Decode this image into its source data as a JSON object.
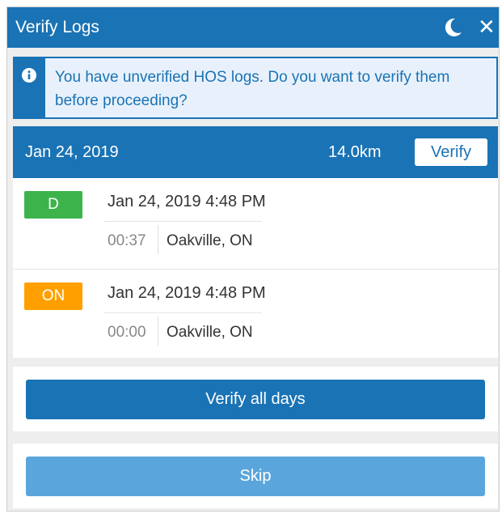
{
  "window": {
    "title": "Verify Logs"
  },
  "titlebar": {
    "theme_icon": "moon-icon",
    "close_glyph": "✕"
  },
  "alert": {
    "icon": "info-icon",
    "message": "You have unverified HOS logs. Do you want to verify them before proceeding?"
  },
  "day": {
    "date": "Jan 24, 2019",
    "distance": "14.0km",
    "verify_label": "Verify",
    "entries": [
      {
        "status": "D",
        "status_color": "#3cb44b",
        "timestamp": "Jan 24, 2019 4:48 PM",
        "duration": "00:37",
        "location": "Oakville, ON"
      },
      {
        "status": "ON",
        "status_color": "#ffa000",
        "timestamp": "Jan 24, 2019 4:48 PM",
        "duration": "00:00",
        "location": "Oakville, ON"
      }
    ]
  },
  "actions": {
    "verify_all_label": "Verify all days",
    "skip_label": "Skip"
  },
  "colors": {
    "primary": "#1a73b5",
    "skip": "#5aa6dc",
    "alert_bg": "#e8f1fb"
  }
}
